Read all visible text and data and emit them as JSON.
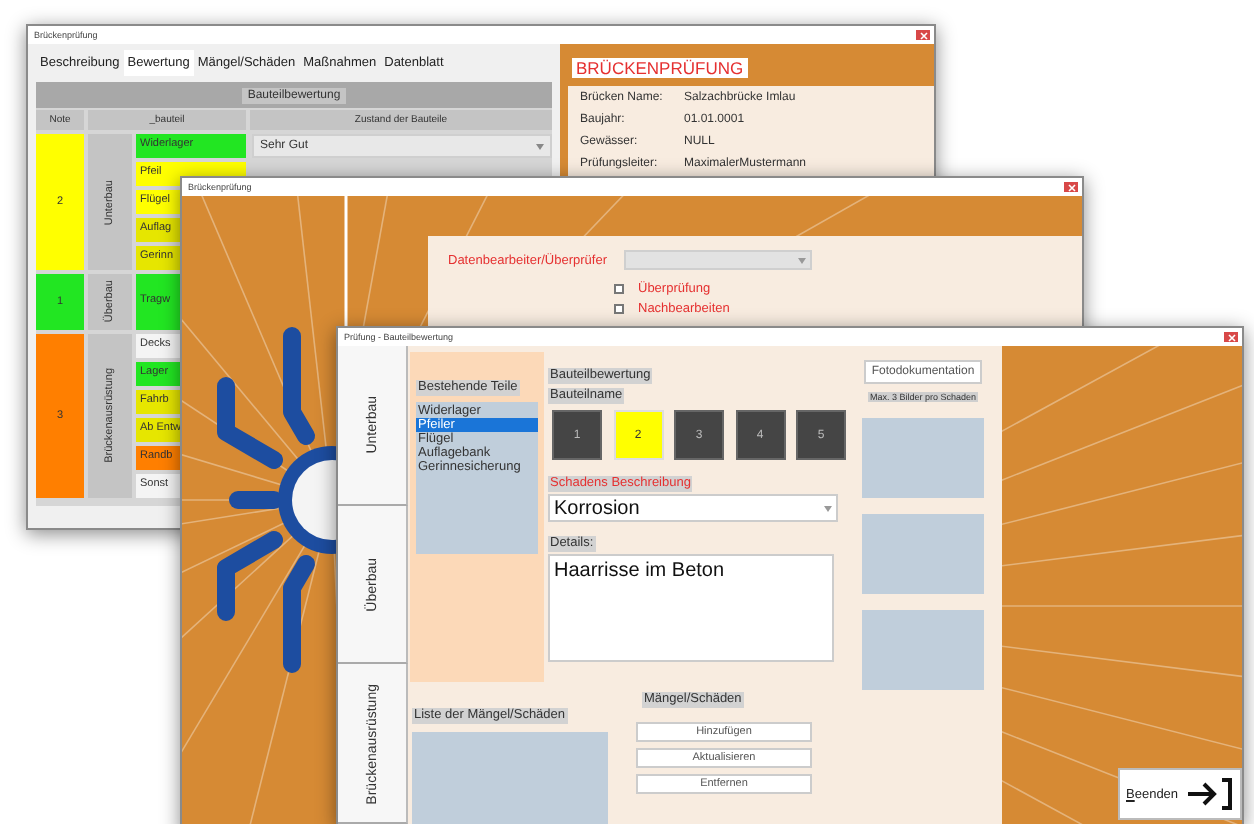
{
  "rating_window": {
    "title": "Brückenprüfung",
    "tabs": [
      {
        "label": "Beschreibung",
        "selected": false
      },
      {
        "label": "Bewertung",
        "selected": true
      },
      {
        "label": "Mängel/Schäden",
        "selected": false
      },
      {
        "label": "Maßnahmen",
        "selected": false
      },
      {
        "label": "Datenblatt",
        "selected": false
      }
    ],
    "table": {
      "title": "Bauteilbewertung",
      "columns": [
        "Note",
        "_bauteil",
        "Zustand der Bauteile"
      ],
      "groups": [
        {
          "note": "2",
          "color": "#ffff00",
          "name": "Unterbau",
          "components": [
            {
              "name": "Widerlager",
              "color": "#22e622",
              "condition": "Sehr Gut"
            },
            {
              "name": "Pfeil",
              "color": "#ffff00"
            },
            {
              "name": "Flügel",
              "color": "#ffff00"
            },
            {
              "name": "Auflag",
              "color": "#e6e600"
            },
            {
              "name": "Gerinn",
              "color": "#e6e600"
            }
          ]
        },
        {
          "note": "1",
          "color": "#22e622",
          "name": "Überbau",
          "components": [
            {
              "name": "Tragw",
              "color": "#22e622"
            }
          ]
        },
        {
          "note": "3",
          "color": "#ff7f00",
          "name": "Brückenausrüstung",
          "components": [
            {
              "name": "Decks",
              "color": "#f4f4f4"
            },
            {
              "name": "Lager",
              "color": "#22e622"
            },
            {
              "name": "Fahrb",
              "color": "#e6e600"
            },
            {
              "name": "Ab Entw",
              "color": "#e6e600"
            },
            {
              "name": "Randb",
              "color": "#ff7f00"
            },
            {
              "name": "Sonst",
              "color": "#f4f4f4"
            }
          ]
        }
      ]
    },
    "info": {
      "heading": "BRÜCKENPRÜFUNG",
      "fields": [
        {
          "label": "Brücken Name:",
          "value": "Salzachbrücke Imlau"
        },
        {
          "label": "Baujahr:",
          "value": "01.01.0001"
        },
        {
          "label": "Gewässer:",
          "value": "NULL"
        },
        {
          "label": "Prüfungsleiter:",
          "value": "MaximalerMustermann"
        }
      ]
    }
  },
  "inspector_window": {
    "title": "Brückenprüfung",
    "editor_label": "Datenbearbeiter/Überprüfer",
    "checkboxes": [
      {
        "label": "Überprüfung",
        "checked": false
      },
      {
        "label": "Nachbearbeiten",
        "checked": false
      }
    ]
  },
  "component_window": {
    "title": "Prüfung - Bauteilbewertung",
    "side_tabs": [
      "Unterbau",
      "Überbau",
      "Brückenausrüstung"
    ],
    "parts": {
      "title": "Bestehende Teile",
      "items": [
        {
          "label": "Widerlager",
          "selected": false
        },
        {
          "label": "Pfeiler",
          "selected": true
        },
        {
          "label": "Flügel",
          "selected": false
        },
        {
          "label": "Auflagebank",
          "selected": false
        },
        {
          "label": "Gerinnesicherung",
          "selected": false
        }
      ]
    },
    "rating": {
      "title": "Bauteilbewertung",
      "subtitle": "Bauteilname",
      "options": [
        {
          "label": "1",
          "selected": false
        },
        {
          "label": "2",
          "selected": true
        },
        {
          "label": "3",
          "selected": false
        },
        {
          "label": "4",
          "selected": false
        },
        {
          "label": "5",
          "selected": false
        }
      ]
    },
    "damage": {
      "label": "Schadens Beschreibung",
      "value": "Korrosion"
    },
    "details": {
      "label": "Details:",
      "value": "Haarrisse im Beton"
    },
    "defects": {
      "list_label": "Liste der Mängel/Schäden",
      "actions_label": "Mängel/Schäden",
      "actions": [
        "Hinzufügen",
        "Aktualisieren",
        "Entfernen"
      ]
    },
    "photos": {
      "button": "Fotodokumentation",
      "hint": "Max. 3 Bilder pro Schaden",
      "slots": [
        {
          "kind": "empty"
        },
        {
          "kind": "empty"
        },
        {
          "kind": "empty"
        }
      ]
    },
    "exit_button": "Beenden"
  }
}
